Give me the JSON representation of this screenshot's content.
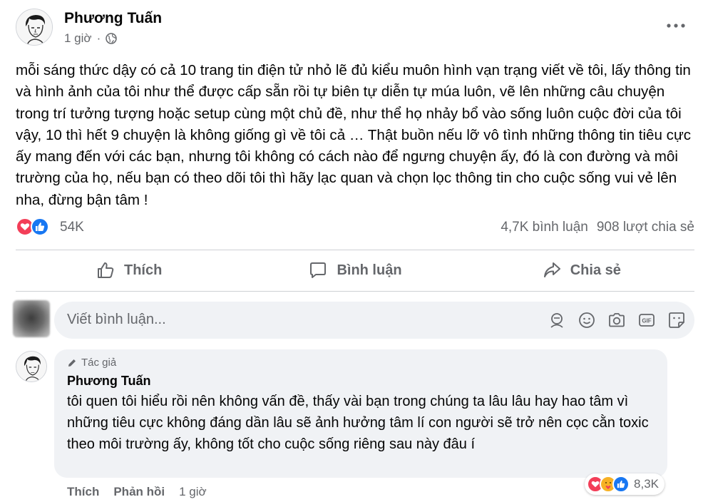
{
  "post": {
    "author": "Phương Tuấn",
    "time": "1 giờ",
    "privacy_icon": "globe-icon",
    "text": "mỗi sáng thức dậy có cả 10 trang tin điện tử nhỏ lẽ đủ kiểu muôn hình vạn trạng viết về tôi, lấy thông tin và hình ảnh của tôi như thể được cấp sẵn rồi tự biên tự diễn tự múa luôn, vẽ lên những câu chuyện trong trí tưởng tượng hoặc setup cùng một chủ đề, như thể họ nhảy bổ vào sống luôn cuộc đời của tôi vậy, 10 thì hết 9 chuyện là không giống gì về tôi cả … Thật buồn nếu lỡ vô tình những thông tin tiêu cực ấy mang đến với các bạn, nhưng tôi không có cách nào để ngưng chuyện ấy, đó là con đường và môi trường của họ, nếu bạn có theo dõi tôi thì hãy lạc quan và chọn lọc thông tin cho cuộc sống vui vẻ lên nha, đừng bận tâm !"
  },
  "reactions": {
    "icons": [
      "love-icon",
      "like-icon"
    ],
    "count": "54K",
    "comments": "4,7K bình luận",
    "shares": "908 lượt chia sẻ"
  },
  "actions": {
    "like": "Thích",
    "comment": "Bình luận",
    "share": "Chia sẻ"
  },
  "comment_box": {
    "placeholder": "Viết bình luận...",
    "tools": [
      "avatar-sticker-icon",
      "emoji-icon",
      "camera-icon",
      "gif-icon",
      "sticker-icon"
    ]
  },
  "reply": {
    "badge": "Tác giả",
    "author": "Phương Tuấn",
    "text": "tôi quen tôi hiểu rồi nên không vấn đề, thấy vài bạn trong chúng ta lâu lâu hay hao tâm vì những tiêu cực không đáng dần lâu sẽ ảnh hưởng tâm lí con người sẽ trở nên cọc cằn toxic theo môi trường ấy, không tốt cho cuộc sống riêng sau này đâu í",
    "reaction_count": "8,3K",
    "like": "Thích",
    "respond": "Phản hồi",
    "time": "1 giờ"
  },
  "colors": {
    "text_primary": "#050505",
    "text_secondary": "#65676b",
    "input_bg": "#f0f2f5",
    "like_blue": "#1877f2",
    "love_red": "#f33e58",
    "care_yellow": "#f7b125"
  }
}
